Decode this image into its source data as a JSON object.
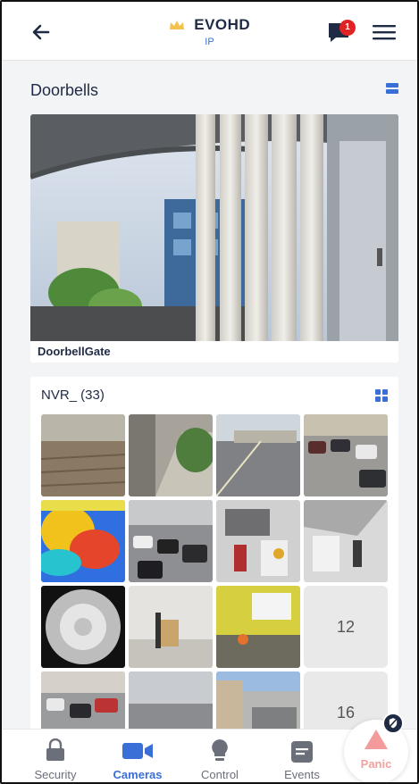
{
  "header": {
    "title": "EVOHD",
    "subtitle": "IP",
    "notification_count": "1",
    "accent_color": "#3b6fd8",
    "crown_color": "#f2c14e",
    "back_icon": "back-arrow-icon",
    "menu_icon": "hamburger-menu-icon",
    "messages_icon": "message-icon"
  },
  "doorbells": {
    "title": "Doorbells",
    "camera": {
      "label": "DoorbellGate"
    }
  },
  "nvr": {
    "title": "NVR_ (33)",
    "thumbnails": [
      "camera-1",
      "camera-2",
      "camera-3",
      "camera-4",
      "thermal-camera",
      "camera-6",
      "camera-7",
      "camera-8",
      "fisheye-camera",
      "camera-10",
      "camera-11"
    ],
    "more_tiles": [
      "12",
      "16"
    ]
  },
  "tabs": [
    {
      "label": "Security",
      "icon": "lock-icon"
    },
    {
      "label": "Cameras",
      "icon": "camera-icon"
    },
    {
      "label": "Control",
      "icon": "lightbulb-icon"
    },
    {
      "label": "Events",
      "icon": "events-icon"
    }
  ],
  "panic": {
    "label": "Panic",
    "color": "#e35b5b"
  }
}
